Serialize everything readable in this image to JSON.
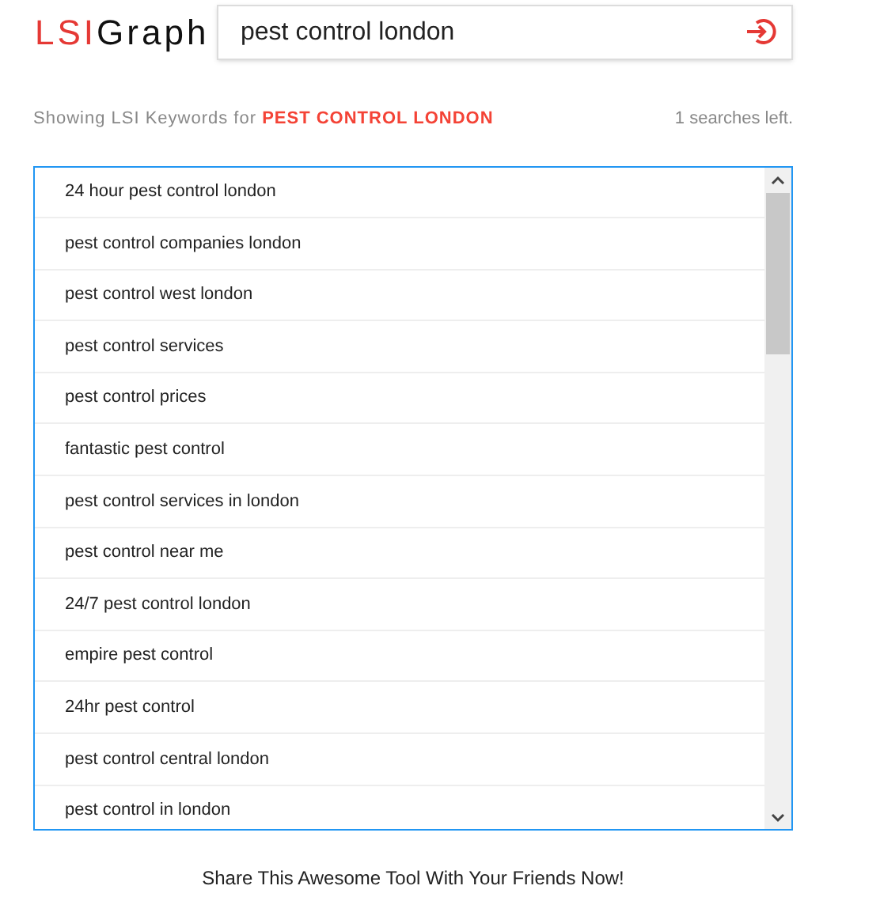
{
  "logo": {
    "accent": "LSI",
    "text": "Graph"
  },
  "search": {
    "value": "pest control london"
  },
  "info": {
    "prefix": "Showing LSI Keywords for",
    "query": "PEST CONTROL LONDON",
    "remaining": "1 searches left."
  },
  "keywords": [
    "24 hour pest control london",
    "pest control companies london",
    "pest control west london",
    "pest control services",
    "pest control prices",
    "fantastic pest control",
    "pest control services in london",
    "pest control near me",
    "24/7 pest control london",
    "empire pest control",
    "24hr pest control",
    "pest control central london",
    "pest control in london"
  ],
  "footer": "Share This Awesome Tool With Your Friends Now!"
}
